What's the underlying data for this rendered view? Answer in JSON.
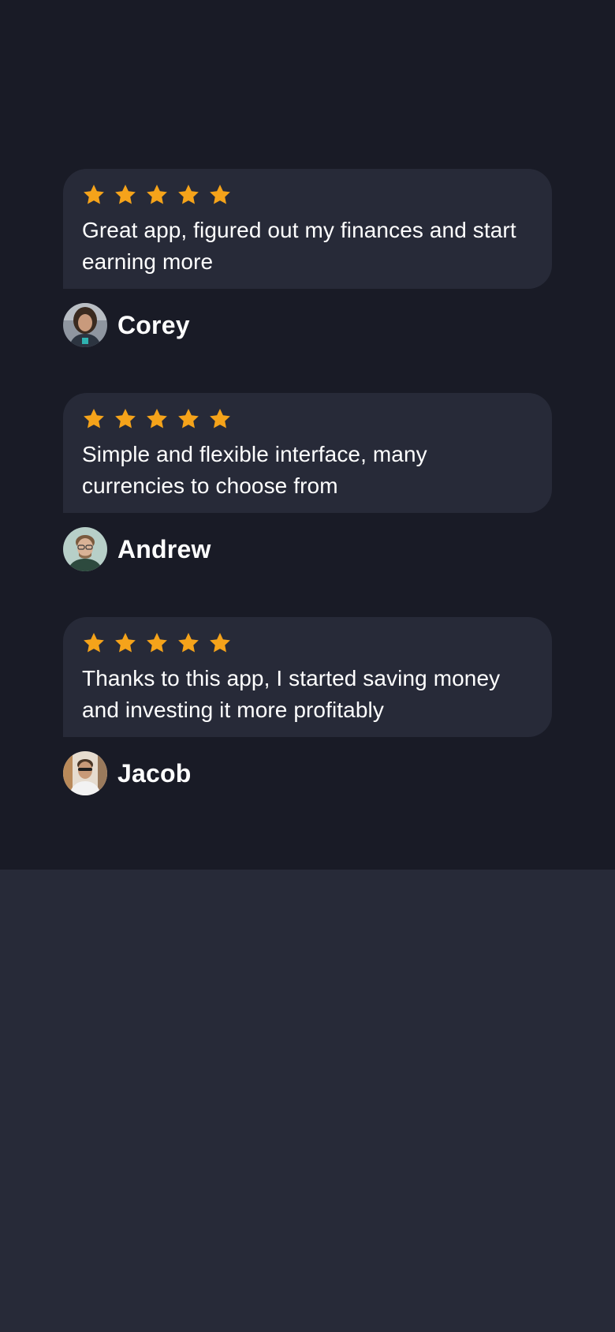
{
  "colors": {
    "background_top": "#191b26",
    "background_bottom": "#272a38",
    "card": "#272a38",
    "star": "#f5a31a",
    "text": "#ffffff"
  },
  "reviews": [
    {
      "rating": 5,
      "text": "Great app, figured out my finances and start earning more",
      "author": "Corey",
      "avatar_icon": "user-avatar"
    },
    {
      "rating": 5,
      "text": "Simple and flexible interface, many currencies to choose from",
      "author": "Andrew",
      "avatar_icon": "user-avatar"
    },
    {
      "rating": 5,
      "text": "Thanks to this app, I started saving money and investing it more profitably",
      "author": "Jacob",
      "avatar_icon": "user-avatar"
    }
  ]
}
